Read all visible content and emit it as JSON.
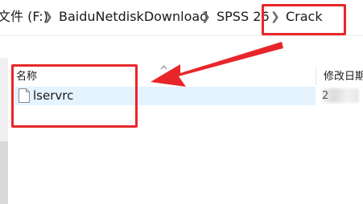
{
  "address_bar": {
    "crumbs": [
      {
        "label": "文件 (F:)"
      },
      {
        "label": "BaiduNetdiskDownload"
      },
      {
        "label": "SPSS 26"
      },
      {
        "label": "Crack"
      }
    ]
  },
  "file_list": {
    "columns": {
      "name": "名称",
      "modified": "修改日期"
    },
    "files": [
      {
        "name": "lservrc",
        "modified_visible_char": "2"
      }
    ]
  },
  "icons": {
    "chevron": "chevron-right-icon",
    "sort": "sort-up-icon",
    "file": "generic-file-icon"
  },
  "colors": {
    "annotation_red": "#e8262a",
    "selection_bg": "#e5f3ff"
  }
}
